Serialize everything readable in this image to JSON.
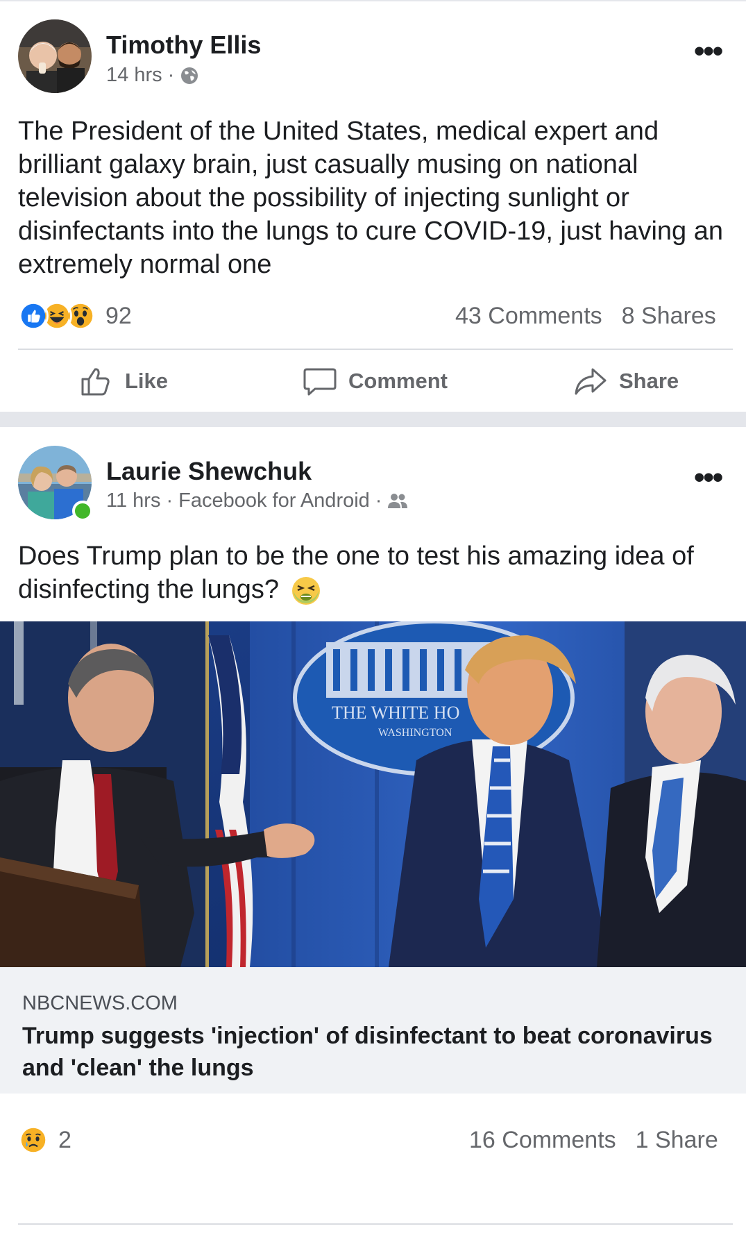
{
  "posts": [
    {
      "author": "Timothy Ellis",
      "time": "14 hrs",
      "audience_icon": "globe-icon",
      "text": "The President of the United States, medical expert and brilliant galaxy brain, just casually musing on national television about the possibility of injecting sunlight or disinfectants into the lungs to cure COVID-19, just having an extremely normal one",
      "reactions": [
        "like",
        "haha",
        "wow"
      ],
      "reaction_count": "92",
      "comments": "43 Comments",
      "shares": "8 Shares",
      "actions": {
        "like": "Like",
        "comment": "Comment",
        "share": "Share"
      }
    },
    {
      "author": "Laurie Shewchuk",
      "time": "11 hrs",
      "source": "Facebook for Android",
      "audience_icon": "friends-icon",
      "text": "Does Trump plan to be the one to test his amazing idea of disinfecting the lungs?",
      "emoji_icon": "nauseated-face-icon",
      "link": {
        "domain": "NBCNEWS.COM",
        "title": "Trump suggests 'injection' of disinfectant to beat coronavirus and 'clean' the lungs"
      },
      "photo_sign": {
        "line1": "THE WHITE HO",
        "line2": "WASHINGTON"
      },
      "reactions": [
        "sad"
      ],
      "reaction_count": "2",
      "comments": "16 Comments",
      "shares": "1 Share"
    }
  ],
  "colors": {
    "like_blue": "#1877f2",
    "reaction_yellow": "#f7b125",
    "divider_gray": "#e4e6eb",
    "online_green": "#42b72a"
  }
}
